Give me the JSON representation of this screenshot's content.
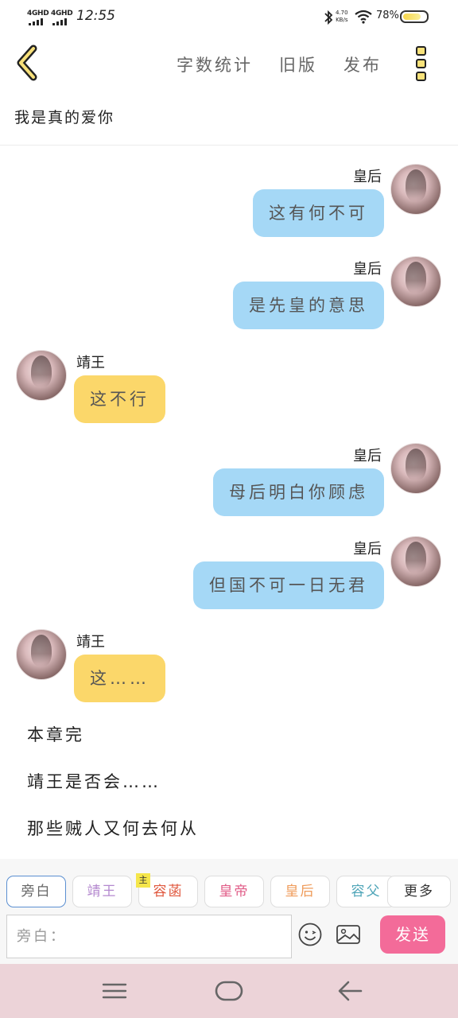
{
  "status_bar": {
    "network_1": "4GHD",
    "network_2": "4GHD",
    "time": "12:55",
    "net_speed_value": "4.70",
    "net_speed_unit": "KB/s",
    "battery": "78%",
    "battery_level": 0.78,
    "icons": [
      "signal-icon",
      "bluetooth-icon",
      "wifi-icon",
      "battery-icon"
    ]
  },
  "header": {
    "back_icon": "chevron-left-icon",
    "word_count": "字数统计",
    "old_version": "旧版",
    "publish": "发布",
    "more_icon": "vertical-dots-icon"
  },
  "chapter": {
    "title": "我是真的爱你"
  },
  "messages": [
    {
      "side": "right",
      "speaker": "皇后",
      "text": "这有何不可"
    },
    {
      "side": "right",
      "speaker": "皇后",
      "text": "是先皇的意思"
    },
    {
      "side": "left",
      "speaker": "靖王",
      "text": "这不行"
    },
    {
      "side": "right",
      "speaker": "皇后",
      "text": "母后明白你顾虑"
    },
    {
      "side": "right",
      "speaker": "皇后",
      "text": "但国不可一日无君"
    },
    {
      "side": "left",
      "speaker": "靖王",
      "text": "这……"
    }
  ],
  "narration": [
    "本章完",
    "靖王是否会……",
    "那些贼人又何去何从"
  ],
  "roles": {
    "items": [
      "旁白",
      "靖王",
      "容菡",
      "皇帝",
      "皇后",
      "容父",
      "更多"
    ],
    "colors": [
      "#666666",
      "#b488cf",
      "#e0583e",
      "#e05a86",
      "#ef9b5a",
      "#4fa5b8",
      "#333333"
    ],
    "active": "旁白",
    "main_badge": "主",
    "main_index": 2
  },
  "composer": {
    "placeholder": "旁白：",
    "send": "发送",
    "emoji_icon": "smiley-icon",
    "image_icon": "image-icon"
  },
  "nav": {
    "icons": [
      "menu-icon",
      "home-icon",
      "back-icon"
    ]
  }
}
